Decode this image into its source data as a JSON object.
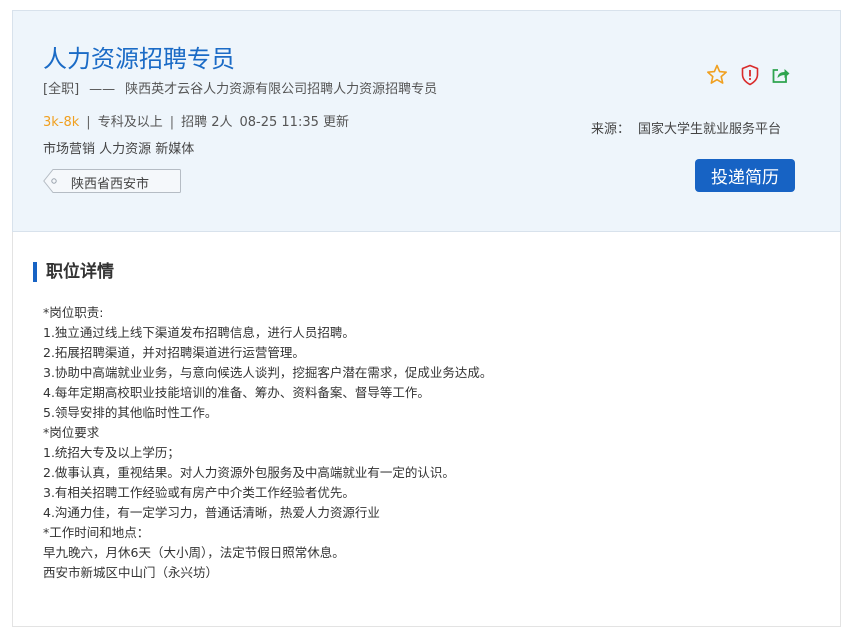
{
  "job": {
    "title": "人力资源招聘专员",
    "type": "[全职]",
    "dash": "——",
    "company": "陕西英才云谷人力资源有限公司招聘人力资源招聘专员",
    "salary": "3k-8k",
    "education": "专科及以上",
    "headcount": "招聘 2人",
    "updated": "08-25 11:35 更新",
    "separator": "|",
    "tags": "市场营销 人力资源 新媒体",
    "location": "陕西省西安市"
  },
  "actions": {
    "icons": [
      "star-icon",
      "shield-icon",
      "share-icon"
    ],
    "colors": {
      "star": "#f0a020",
      "shield": "#d92b2b",
      "share": "#2ea44f"
    },
    "apply_label": "投递简历"
  },
  "source": {
    "label": "来源：",
    "value": "国家大学生就业服务平台"
  },
  "detail": {
    "section_title": "职位详情",
    "lines": [
      "*岗位职责:",
      "1.独立通过线上线下渠道发布招聘信息，进行人员招聘。",
      "2.拓展招聘渠道，并对招聘渠道进行运营管理。",
      "3.协助中高端就业业务，与意向候选人谈判，挖掘客户潜在需求，促成业务达成。",
      "4.每年定期高校职业技能培训的准备、筹办、资料备案、督导等工作。",
      "5.领导安排的其他临时性工作。",
      "*岗位要求",
      "1.统招大专及以上学历；",
      "2.做事认真，重视结果。对人力资源外包服务及中高端就业有一定的认识。",
      "3.有相关招聘工作经验或有房产中介类工作经验者优先。",
      "4.沟通力佳，有一定学习力，普通话清晰，热爱人力资源行业",
      "*工作时间和地点：",
      "早九晚六，月休6天（大小周），法定节假日照常休息。",
      "西安市新城区中山门（永兴坊）"
    ]
  },
  "theme": {
    "accent": "#1763c4",
    "title_blue": "#1b6bc6",
    "salary_orange": "#f0a020",
    "header_bg": "#eef5fb"
  }
}
